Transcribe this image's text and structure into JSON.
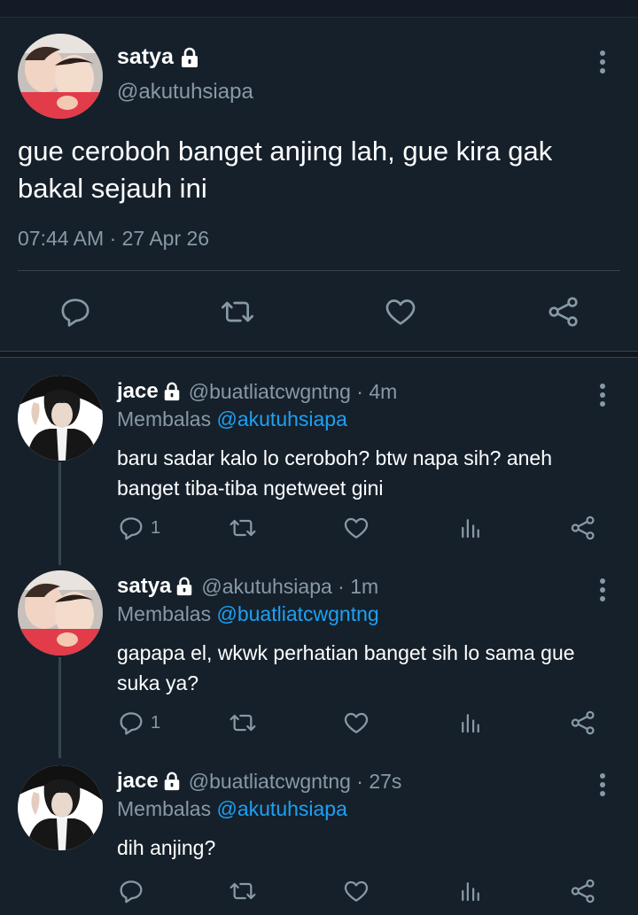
{
  "main_tweet": {
    "name": "satya",
    "handle": "@akutuhsiapa",
    "text": "gue ceroboh banget anjing lah, gue kira gak bakal sejauh ini",
    "meta": "07:44 AM · 27 Apr 26"
  },
  "replies": [
    {
      "name": "jace",
      "handle": "@buatliatcwgntng · 4m",
      "replying_prefix": "Membalas",
      "replying_to": "@akutuhsiapa",
      "text": "baru sadar kalo lo ceroboh? btw napa sih? aneh banget tiba-tiba ngetweet gini",
      "reply_count": "1"
    },
    {
      "name": "satya",
      "handle": "@akutuhsiapa · 1m",
      "replying_prefix": "Membalas",
      "replying_to": "@buatliatcwgntng",
      "text": "gapapa el, wkwk perhatian banget sih lo sama gue suka ya?",
      "reply_count": "1"
    },
    {
      "name": "jace",
      "handle": "@buatliatcwgntng · 27s",
      "replying_prefix": "Membalas",
      "replying_to": "@akutuhsiapa",
      "text": "dih anjing?",
      "reply_count": ""
    }
  ],
  "colors": {
    "background": "#15202b",
    "secondary_text": "#8899a6",
    "link": "#1da1f2",
    "divider": "#38444d"
  },
  "icons": {
    "lock": "lock-icon",
    "more": "more-vertical-icon",
    "reply": "reply-icon",
    "retweet": "retweet-icon",
    "like": "heart-icon",
    "share": "share-icon",
    "analytics": "analytics-icon"
  }
}
